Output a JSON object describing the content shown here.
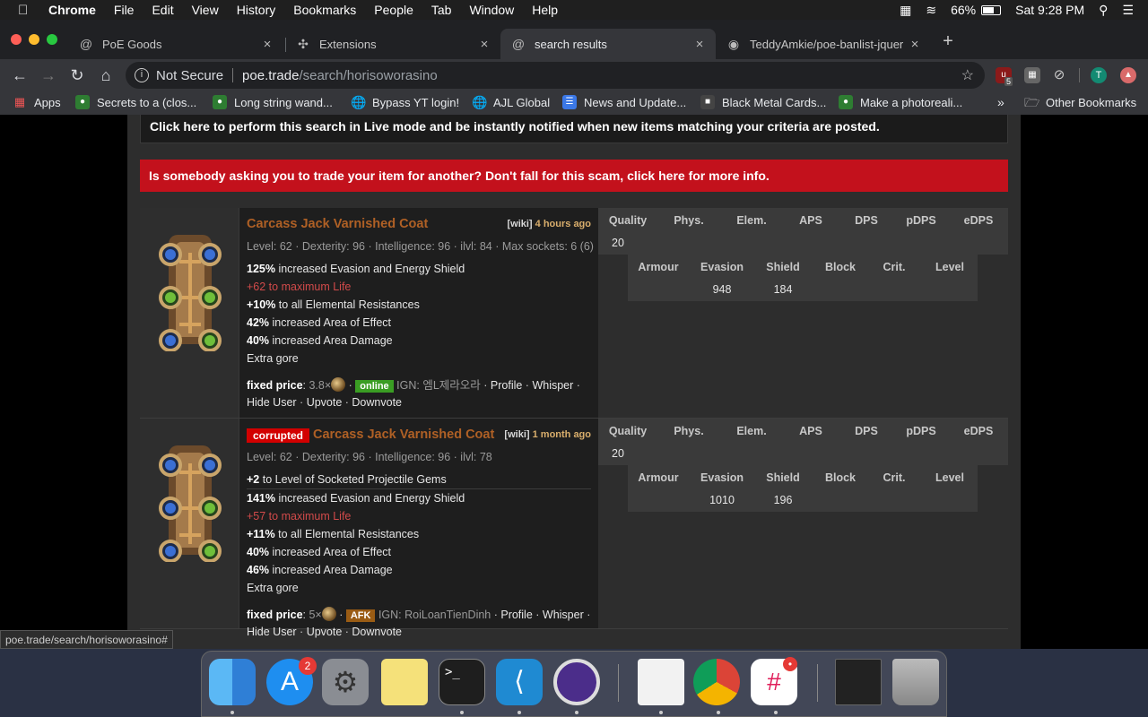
{
  "menubar": {
    "app": "Chrome",
    "items": [
      "File",
      "Edit",
      "View",
      "History",
      "Bookmarks",
      "People",
      "Tab",
      "Window",
      "Help"
    ],
    "battery": "66%",
    "clock": "Sat 9:28 PM"
  },
  "tabs": [
    {
      "label": "PoE Goods",
      "icon": "poe-icon"
    },
    {
      "label": "Extensions",
      "icon": "puzzle-icon"
    },
    {
      "label": "search results",
      "icon": "poe-icon"
    },
    {
      "label": "TeddyAmkie/poe-banlist-jquer",
      "icon": "github-icon"
    }
  ],
  "toolbar": {
    "security": "Not Secure",
    "url_host": "poe.trade",
    "url_path": "/search/horisoworasino",
    "ext_badge": "5",
    "profile_initial": "T"
  },
  "bookmarks": {
    "apps": "Apps",
    "items": [
      "Secrets to a (clos...",
      "Long string wand...",
      "Bypass YT login!",
      "AJL Global",
      "News and Update...",
      "Black Metal Cards...",
      "Make a photoreali..."
    ],
    "more": "»",
    "other": "Other Bookmarks"
  },
  "page": {
    "live_text": "Click here to perform this search in Live mode and be instantly notified when new items matching your criteria are posted.",
    "scam_text": "Is somebody asking you to trade your item for another? Don't fall for this scam, click here for more info.",
    "colors": {
      "item_name": "#af6025",
      "scam_bg": "#c3111c",
      "online": "#3a9d23",
      "afk": "#9a5c14",
      "life_mod": "#d14a4a"
    },
    "items": [
      {
        "name": "Carcass Jack Varnished Coat",
        "corrupted": "",
        "wiki": "[wiki]",
        "age": "4 hours ago",
        "reqs": "Level: 62 · Dexterity: 96 · Intelligence: 96 · ilvl: 84 · Max sockets: 6 (6)",
        "mods": [
          {
            "num": "125%",
            "text": " increased Evasion and Energy Shield"
          },
          {
            "num": "",
            "text": "+62 to maximum Life",
            "life": true
          },
          {
            "num": "+10%",
            "text": " to all Elemental Resistances"
          },
          {
            "num": "42%",
            "text": " increased Area of Effect"
          },
          {
            "num": "40%",
            "text": " increased Area Damage"
          },
          {
            "num": "",
            "text": "Extra gore"
          }
        ],
        "price_label": "fixed price",
        "price_value": "3.8×",
        "status": "online",
        "ign": "IGN: 엠L제라오라",
        "links": [
          "Profile",
          "Whisper",
          "Hide User",
          "Upvote",
          "Downvote"
        ],
        "weapon_headers": [
          "Quality",
          "Phys.",
          "Elem.",
          "APS",
          "DPS",
          "pDPS",
          "eDPS"
        ],
        "quality": "20",
        "defense_headers": [
          "Armour",
          "Evasion",
          "Shield",
          "Block",
          "Crit.",
          "Level"
        ],
        "evasion": "948",
        "shield": "184"
      },
      {
        "name": "Carcass Jack Varnished Coat",
        "corrupted": "corrupted",
        "wiki": "[wiki]",
        "age": "1 month ago",
        "reqs": "Level: 62 · Dexterity: 96 · Intelligence: 96 · ilvl: 78",
        "implicit": {
          "num": "+2",
          "text": " to Level of Socketed Projectile Gems"
        },
        "mods": [
          {
            "num": "141%",
            "text": " increased Evasion and Energy Shield"
          },
          {
            "num": "",
            "text": "+57 to maximum Life",
            "life": true
          },
          {
            "num": "+11%",
            "text": " to all Elemental Resistances"
          },
          {
            "num": "40%",
            "text": " increased Area of Effect"
          },
          {
            "num": "46%",
            "text": " increased Area Damage"
          },
          {
            "num": "",
            "text": "Extra gore"
          }
        ],
        "price_label": "fixed price",
        "price_value": "5×",
        "status": "AFK",
        "ign": "IGN: RoiLoanTienDinh",
        "links": [
          "Profile",
          "Whisper",
          "Hide User",
          "Upvote",
          "Downvote"
        ],
        "weapon_headers": [
          "Quality",
          "Phys.",
          "Elem.",
          "APS",
          "DPS",
          "pDPS",
          "eDPS"
        ],
        "quality": "20",
        "defense_headers": [
          "Armour",
          "Evasion",
          "Shield",
          "Block",
          "Crit.",
          "Level"
        ],
        "evasion": "1010",
        "shield": "196"
      }
    ]
  },
  "status_url": "poe.trade/search/horisoworasino#",
  "dock": {
    "apps": [
      "Finder",
      "App Store",
      "System Preferences",
      "Notes",
      "Terminal",
      "VS Code",
      "Tor Browser",
      "TextEdit",
      "Chrome",
      "Slack",
      "Screenshot",
      "Trash"
    ],
    "appstore_badge": "2"
  }
}
